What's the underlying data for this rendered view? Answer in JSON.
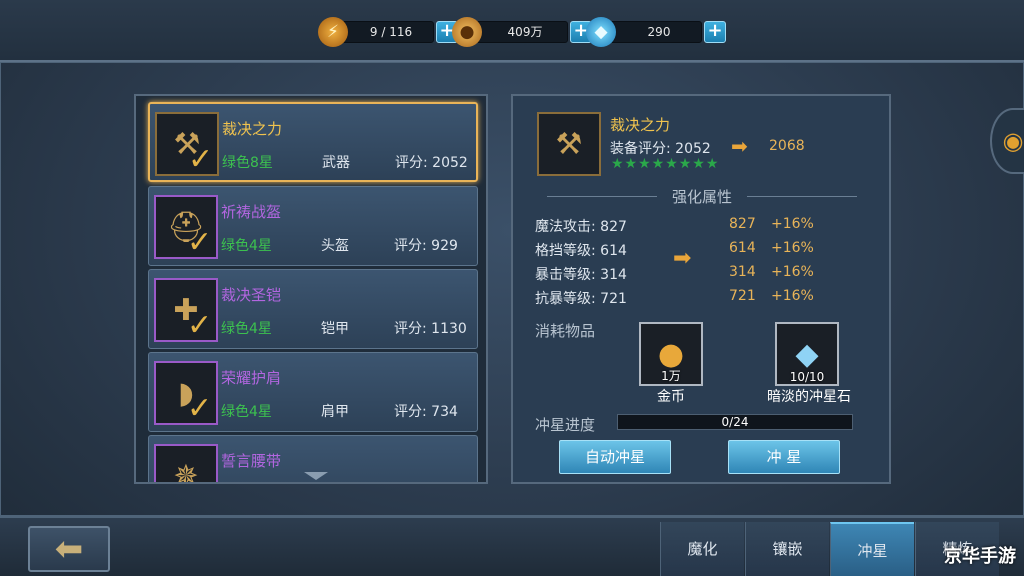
{
  "resources": {
    "energy": {
      "value": "9 / 116",
      "icon": "energy-icon"
    },
    "gold": {
      "value": "409万",
      "icon": "coin-icon"
    },
    "gems": {
      "value": "290",
      "icon": "gem-icon"
    },
    "plus_label": "+"
  },
  "equipment_list": [
    {
      "name": "裁决之力",
      "grade": "绿色8星",
      "slot": "武器",
      "score": "评分: 2052",
      "icon": "hammer-icon",
      "quality": "gold",
      "selected": true
    },
    {
      "name": "祈祷战盔",
      "grade": "绿色4星",
      "slot": "头盔",
      "score": "评分: 929",
      "icon": "helmet-icon",
      "quality": "purple",
      "selected": false
    },
    {
      "name": "裁决圣铠",
      "grade": "绿色4星",
      "slot": "铠甲",
      "score": "评分: 1130",
      "icon": "armor-icon",
      "quality": "purple",
      "selected": false
    },
    {
      "name": "荣耀护肩",
      "grade": "绿色4星",
      "slot": "肩甲",
      "score": "评分: 734",
      "icon": "pauldron-icon",
      "quality": "purple",
      "selected": false
    },
    {
      "name": "誓言腰带",
      "grade": "",
      "slot": "",
      "score": "",
      "icon": "belt-icon",
      "quality": "purple",
      "selected": false
    }
  ],
  "detail": {
    "name": "裁决之力",
    "score": "装备评分: 2052",
    "new_score": "2068",
    "stars": "★★★★★★★★",
    "section_title": "强化属性",
    "attributes": [
      {
        "name": "魔法攻击: 827",
        "new_value": "827",
        "increase": "+16%"
      },
      {
        "name": "格挡等级: 614",
        "new_value": "614",
        "increase": "+16%"
      },
      {
        "name": "暴击等级: 314",
        "new_value": "314",
        "increase": "+16%"
      },
      {
        "name": "抗暴等级: 721",
        "new_value": "721",
        "increase": "+16%"
      }
    ],
    "cost_label": "消耗物品",
    "costs": [
      {
        "name": "金币",
        "qty": "1万",
        "icon": "coin-icon"
      },
      {
        "name": "暗淡的冲星石",
        "qty": "10/10",
        "icon": "crystal-icon"
      }
    ],
    "progress_label": "冲星进度",
    "progress_text": "0/24",
    "progress_fraction": 0,
    "auto_button": "自动冲星",
    "star_button": "冲  星"
  },
  "tabs": [
    "魔化",
    "镶嵌",
    "冲星",
    "精炼"
  ],
  "active_tab": "冲星",
  "watermark": "京华手游",
  "colors": {
    "accent_gold": "#e9b458",
    "grade_green": "#3cc14f",
    "quality_purple": "#b266e0",
    "button_blue": "#2f86b6"
  }
}
